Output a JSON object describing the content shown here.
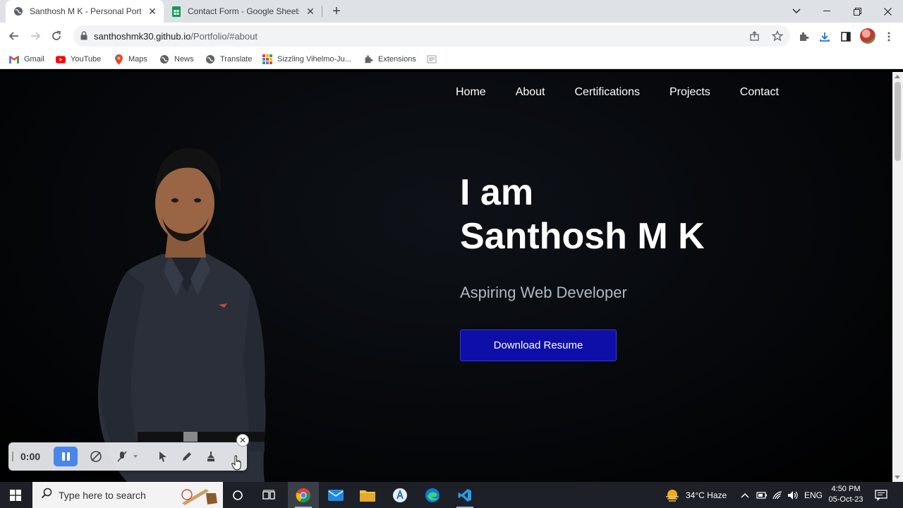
{
  "browser": {
    "tabs": [
      {
        "title": "Santhosh M K - Personal Portfolio",
        "active": true
      },
      {
        "title": "Contact Form - Google Sheets",
        "active": false
      }
    ],
    "url_host": "santhoshmk30.github.io",
    "url_path": "/Portfolio/#about",
    "bookmarks": [
      "Gmail",
      "YouTube",
      "Maps",
      "News",
      "Translate",
      "Sizzling Vihelmo-Ju...",
      "Extensions"
    ]
  },
  "site": {
    "nav": [
      "Home",
      "About",
      "Certifications",
      "Projects",
      "Contact"
    ],
    "hero": {
      "line1": "I am",
      "line2": "Santhosh M K",
      "subtitle": "Aspiring Web Developer",
      "button": "Download Resume"
    }
  },
  "recorder": {
    "time": "0:00"
  },
  "taskbar": {
    "search_placeholder": "Type here to search",
    "weather": "34°C  Haze",
    "language": "ENG",
    "time": "4:50 PM",
    "date": "05-Oct-23"
  },
  "colors": {
    "accent_button": "#0e0ea8",
    "subtitle": "#aeb9c4",
    "recorder_pause": "#4a86e8"
  }
}
